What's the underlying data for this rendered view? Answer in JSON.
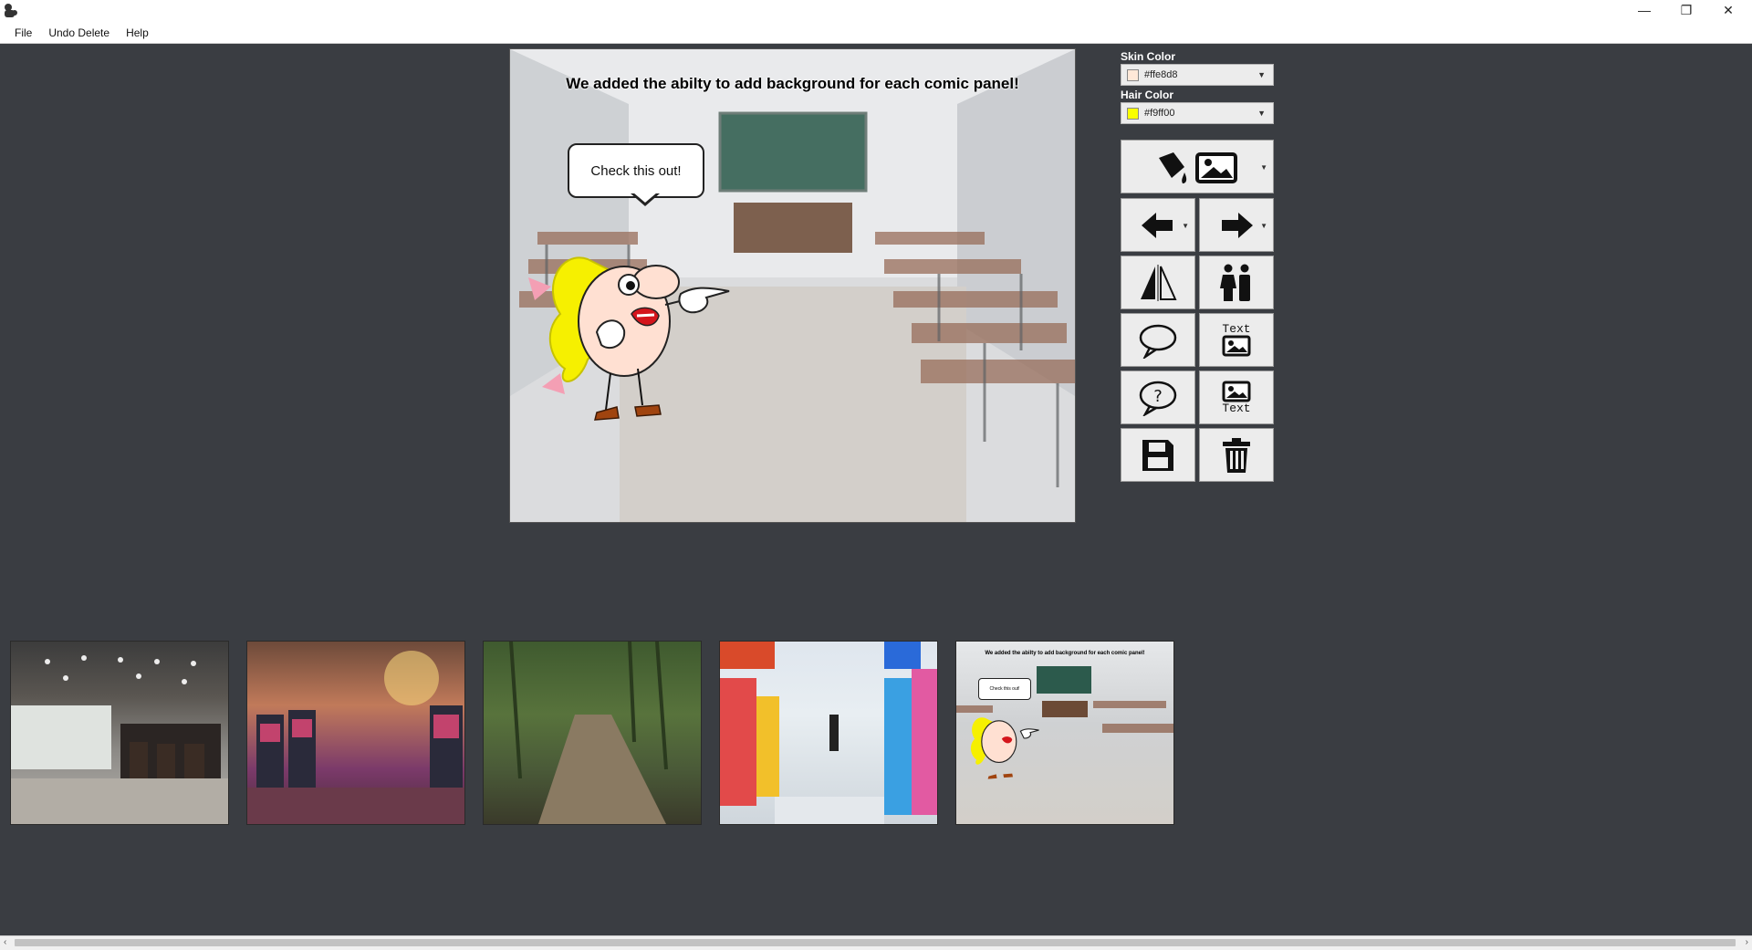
{
  "window": {
    "icon": "gorilla-app-icon",
    "controls": [
      "minimize",
      "restore",
      "close"
    ]
  },
  "menu": {
    "items": [
      "File",
      "Undo Delete",
      "Help"
    ]
  },
  "panel": {
    "title": "We added the abilty to add background for each comic panel!",
    "bubble_text": "Check this out!",
    "background": "classroom"
  },
  "skin": {
    "label": "Skin Color",
    "value": "#ffe8d8",
    "swatch": "#ffe8d8"
  },
  "hair": {
    "label": "Hair Color",
    "value": "#f9ff00",
    "swatch": "#f9ff00"
  },
  "tools": {
    "fill_background": "paint-bucket-image-icon",
    "move_back": "arrow-left-icon",
    "move_forward": "arrow-right-icon",
    "flip": "flip-icon",
    "characters": "people-icon",
    "speech": "speech-bubble-icon",
    "text_above": "Text",
    "thought": "question-bubble-icon",
    "text_below": "Text",
    "save": "floppy-disk-icon",
    "delete": "trash-icon"
  },
  "thumbnails": [
    {
      "name": "restaurant"
    },
    {
      "name": "casino"
    },
    {
      "name": "forest-path"
    },
    {
      "name": "supermarket"
    },
    {
      "name": "classroom-panel",
      "title": "We added the abilty to add background for each comic panel!",
      "bubble": "Check this out!"
    }
  ],
  "scroll": {
    "left": "‹",
    "right": "›"
  }
}
